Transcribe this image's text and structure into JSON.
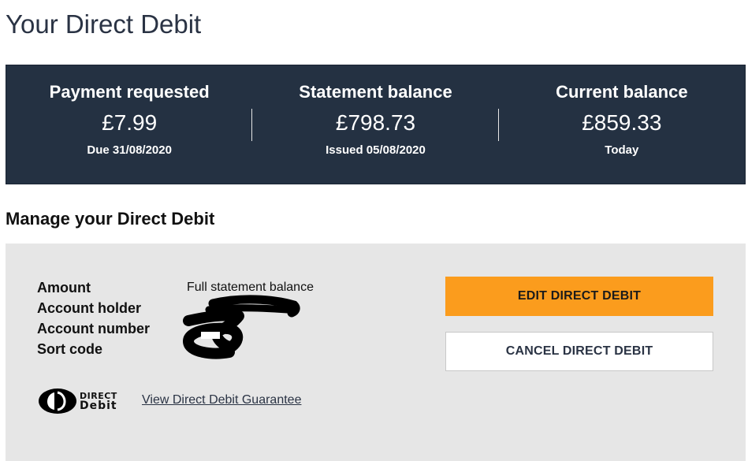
{
  "page": {
    "title": "Your Direct Debit"
  },
  "summary": [
    {
      "label": "Payment requested",
      "amount": "£7.99",
      "sub": "Due 31/08/2020"
    },
    {
      "label": "Statement balance",
      "amount": "£798.73",
      "sub": "Issued 05/08/2020"
    },
    {
      "label": "Current balance",
      "amount": "£859.33",
      "sub": "Today"
    }
  ],
  "manage": {
    "title": "Manage your Direct Debit",
    "details": [
      {
        "label": "Amount",
        "value": "Full statement balance"
      },
      {
        "label": "Account holder",
        "value": ""
      },
      {
        "label": "Account number",
        "value": ""
      },
      {
        "label": "Sort code",
        "value": ""
      }
    ],
    "edit_button": "EDIT DIRECT DEBIT",
    "cancel_button": "CANCEL DIRECT DEBIT",
    "logo": {
      "line1": "DIRECT",
      "line2": "Debit"
    },
    "guarantee_link": "View Direct Debit Guarantee"
  },
  "colors": {
    "summary_bg": "#243142",
    "edit_button_bg": "#fb9c1d",
    "manage_bg": "#e6e6e6"
  }
}
